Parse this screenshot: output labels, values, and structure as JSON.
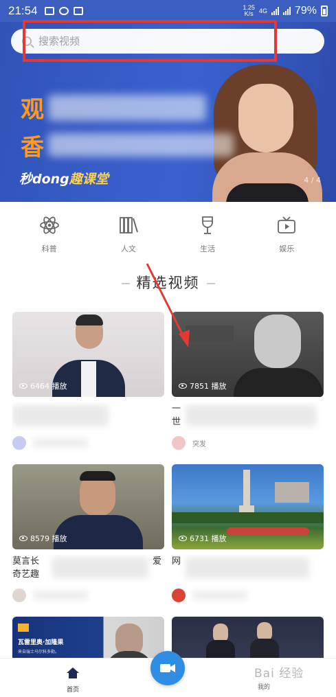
{
  "status_bar": {
    "time": "21:54",
    "network_speed_value": "1.25",
    "network_speed_unit": "K/s",
    "network_type": "4G",
    "battery": "79%"
  },
  "search": {
    "placeholder": "搜索视频"
  },
  "banner": {
    "title_line1": "观",
    "title_line2": "香",
    "brand_left": "秒dong",
    "brand_right": "趣课堂",
    "pager": "4 / 4"
  },
  "categories": [
    {
      "label": "科普",
      "icon": "atom-icon"
    },
    {
      "label": "人文",
      "icon": "books-icon"
    },
    {
      "label": "生活",
      "icon": "wine-glass-icon"
    },
    {
      "label": "娱乐",
      "icon": "tv-icon"
    }
  ],
  "section_title": "精选视频",
  "videos": [
    {
      "views": "6464 播放",
      "title": "",
      "author": ""
    },
    {
      "views": "7851 播放",
      "title": "一 世",
      "author": "突发"
    },
    {
      "views": "8579 播放",
      "title": "莫言长 奇艺趣",
      "title_end": "爱",
      "author": ""
    },
    {
      "views": "6731 播放",
      "title": "网",
      "author": ""
    },
    {
      "views": "",
      "title": "",
      "author": "",
      "thumb_text1": "瓦雷里奥·加隆果",
      "thumb_text2": "来自瑞士马尔科多勒。"
    },
    {
      "views": "",
      "title": "",
      "author": ""
    }
  ],
  "bottom_nav": {
    "home_label": "首页",
    "mine_label": "我的"
  },
  "watermark": "Bai 经验",
  "colors": {
    "banner_blue": "#3a5fc0",
    "highlight_red": "#e53935",
    "record_button_blue": "#2f8de6"
  }
}
